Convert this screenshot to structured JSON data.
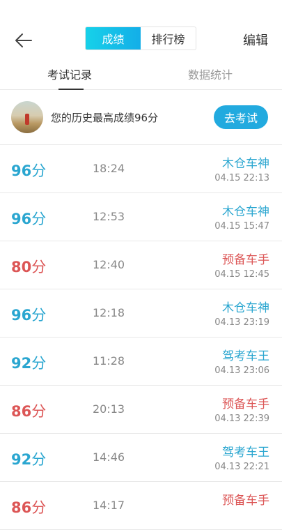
{
  "header": {
    "tabs": [
      {
        "label": "成绩",
        "active": true
      },
      {
        "label": "排行榜",
        "active": false
      }
    ],
    "edit_label": "编辑"
  },
  "subtabs": [
    {
      "label": "考试记录",
      "active": true
    },
    {
      "label": "数据统计",
      "active": false
    }
  ],
  "best": {
    "text": "您的历史最高成绩96分",
    "button_label": "去考试"
  },
  "colors": {
    "accent": "#22aadf",
    "pass": "#2aa6d0",
    "fail": "#dc5656"
  },
  "records": [
    {
      "score": "96",
      "unit": "分",
      "duration": "18:24",
      "title": "木仓车神",
      "date": "04.15  22:13",
      "status": "pass"
    },
    {
      "score": "96",
      "unit": "分",
      "duration": "12:53",
      "title": "木仓车神",
      "date": "04.15  15:47",
      "status": "pass"
    },
    {
      "score": "80",
      "unit": "分",
      "duration": "12:40",
      "title": "预备车手",
      "date": "04.15  12:45",
      "status": "fail"
    },
    {
      "score": "96",
      "unit": "分",
      "duration": "12:18",
      "title": "木仓车神",
      "date": "04.13  23:19",
      "status": "pass"
    },
    {
      "score": "92",
      "unit": "分",
      "duration": "11:28",
      "title": "驾考车王",
      "date": "04.13  23:06",
      "status": "pass"
    },
    {
      "score": "86",
      "unit": "分",
      "duration": "20:13",
      "title": "预备车手",
      "date": "04.13  22:39",
      "status": "fail"
    },
    {
      "score": "92",
      "unit": "分",
      "duration": "14:46",
      "title": "驾考车王",
      "date": "04.13  22:21",
      "status": "pass"
    },
    {
      "score": "86",
      "unit": "分",
      "duration": "14:17",
      "title": "预备车手",
      "date": "",
      "status": "fail"
    }
  ]
}
